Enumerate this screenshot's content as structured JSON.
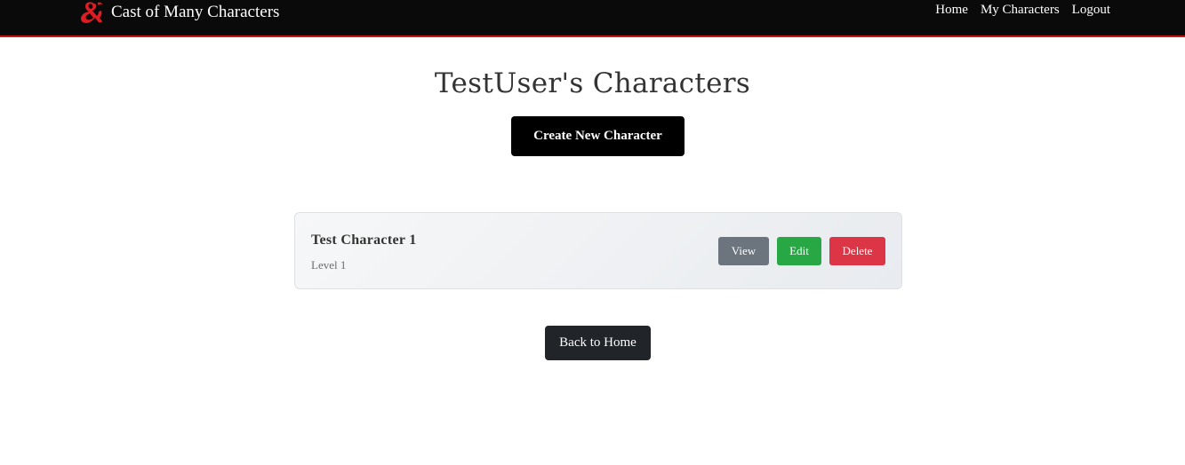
{
  "navbar": {
    "brand_logo": "dnd-ampersand-logo",
    "brand_name": "Cast of Many Characters",
    "links": [
      {
        "label": "Home"
      },
      {
        "label": "My Characters"
      },
      {
        "label": "Logout"
      }
    ]
  },
  "main": {
    "title": "TestUser's Characters",
    "create_button": "Create New Character",
    "characters": [
      {
        "name": "Test Character 1",
        "level": "Level 1",
        "actions": {
          "view": "View",
          "edit": "Edit",
          "delete": "Delete"
        }
      }
    ],
    "back_button": "Back to Home"
  },
  "colors": {
    "navbar_bg": "#0a0a0a",
    "navbar_accent": "#c8161d",
    "view": "#6c757d",
    "edit": "#28a745",
    "delete": "#dc3545"
  }
}
